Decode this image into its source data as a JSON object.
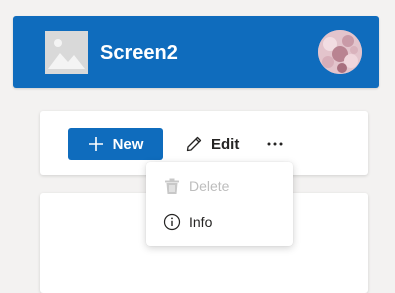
{
  "header": {
    "title": "Screen2",
    "logo_icon": "image-placeholder-icon",
    "avatar_icon": "user-avatar"
  },
  "toolbar": {
    "new_label": "New",
    "new_icon": "plus-icon",
    "edit_label": "Edit",
    "edit_icon": "pencil-icon",
    "more_icon": "more-horizontal-icon"
  },
  "menu": {
    "items": [
      {
        "label": "Delete",
        "icon": "trash-icon",
        "disabled": true
      },
      {
        "label": "Info",
        "icon": "info-icon",
        "disabled": false
      }
    ]
  },
  "colors": {
    "brand": "#0f6cbd",
    "background": "#f3f2f1",
    "disabled_text": "#bdbdbd"
  }
}
